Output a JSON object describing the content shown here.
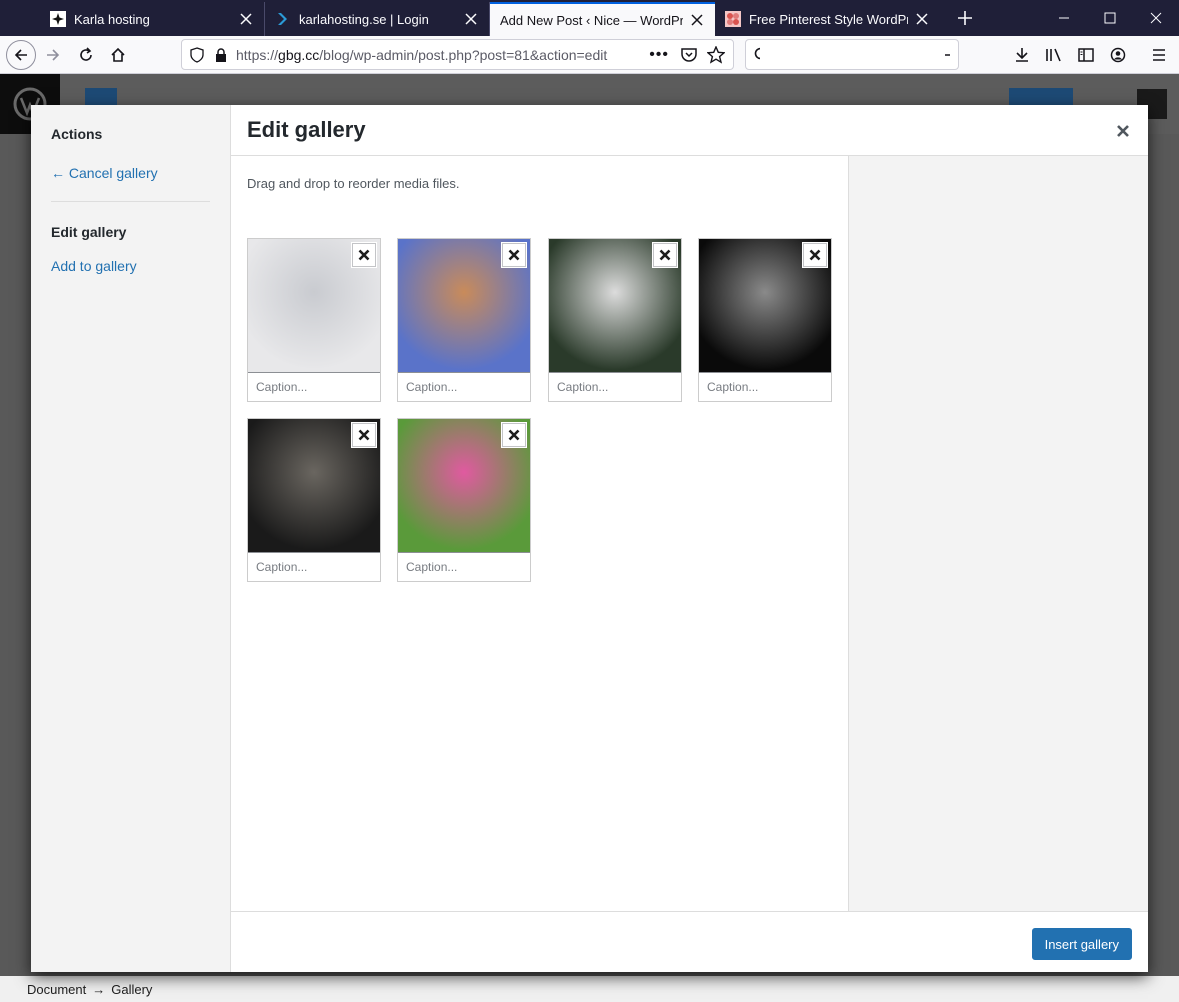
{
  "browser": {
    "tabs": [
      {
        "title": "Karla hosting",
        "icon": "wordpress-star-icon"
      },
      {
        "title": "karlahosting.se | Login",
        "icon": "chevron-logo-icon"
      },
      {
        "title": "Add New Post ‹ Nice — WordPress",
        "icon": "none"
      },
      {
        "title": "Free Pinterest Style WordPress T",
        "icon": "pinwheel-icon"
      }
    ],
    "url_prefix": "https://",
    "url_domain": "gbg.cc",
    "url_path": "/blog/wp-admin/post.php?post=81&action=edit",
    "search_placeholder": ""
  },
  "modal": {
    "title": "Edit gallery",
    "menu": {
      "heading": "Actions",
      "cancel": "← Cancel gallery",
      "current": "Edit gallery",
      "add": "Add to gallery"
    },
    "instructions": "Drag and drop to reorder media files.",
    "caption_placeholder": "Caption...",
    "insert_button": "Insert gallery",
    "images": [
      {
        "name": "white-haired-woman",
        "colors": [
          "#e8e8ea",
          "#c9cbd0"
        ]
      },
      {
        "name": "woman-butterflies",
        "colors": [
          "#5a73c9",
          "#c98b5a"
        ]
      },
      {
        "name": "fairy-in-forest",
        "colors": [
          "#2a3a2a",
          "#dcdcdc"
        ]
      },
      {
        "name": "armored-figure-bw",
        "colors": [
          "#0a0a0a",
          "#8a8a8a"
        ]
      },
      {
        "name": "redhead-in-hall",
        "colors": [
          "#1a1a1a",
          "#6a6660"
        ]
      },
      {
        "name": "woman-in-grass",
        "colors": [
          "#5a9a3a",
          "#e05aa0"
        ]
      }
    ]
  },
  "breadcrumb": {
    "item1": "Document",
    "arrow": "→",
    "item2": "Gallery"
  }
}
